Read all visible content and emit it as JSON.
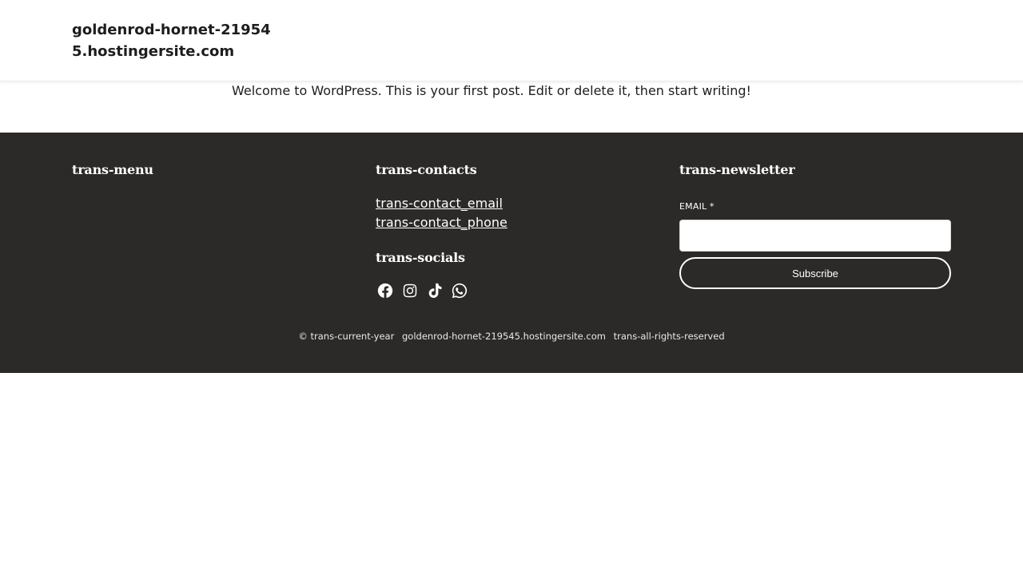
{
  "header": {
    "site_title": "goldenrod-hornet-219545.hostingersite.com"
  },
  "post": {
    "text": "Welcome to WordPress. This is your first post. Edit or delete it, then start writing!"
  },
  "footer": {
    "menu_title": "trans-menu",
    "contacts_title": "trans-contacts",
    "contact_email": "trans-contact_email",
    "contact_phone": "trans-contact_phone",
    "socials_title": "trans-socials",
    "socials": [
      {
        "name": "facebook-icon"
      },
      {
        "name": "instagram-icon"
      },
      {
        "name": "tiktok-icon"
      },
      {
        "name": "whatsapp-icon"
      }
    ],
    "newsletter_title": "trans-newsletter",
    "email_label": "EMAIL *",
    "email_value": "",
    "subscribe_label": "Subscribe",
    "copyright_symbol": "© trans-current-year",
    "copyright_site": "goldenrod-hornet-219545.hostingersite.com",
    "copyright_rights": "trans-all-rights-reserved"
  },
  "colors": {
    "footer_bg": "#2c2a28",
    "text_dark": "#1d1d1d",
    "text_light": "#ffffff"
  }
}
